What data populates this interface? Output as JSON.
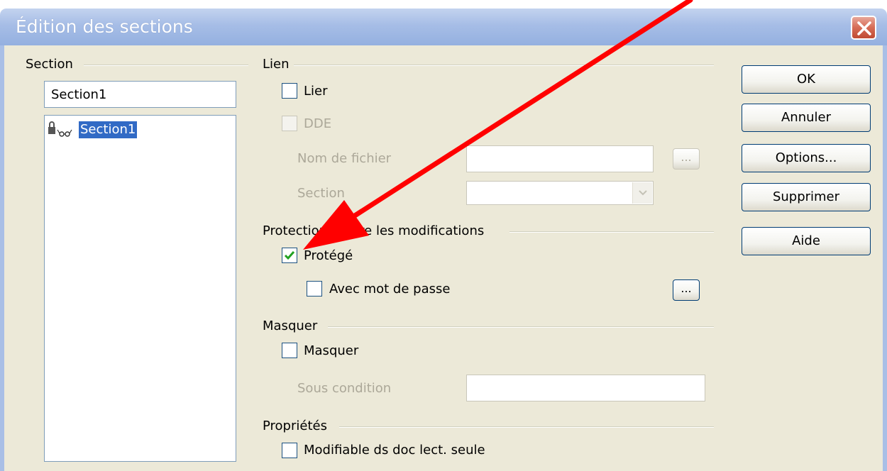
{
  "title": "Édition des sections",
  "section_group": {
    "label": "Section",
    "name_value": "Section1",
    "tree_item": "Section1"
  },
  "lien": {
    "label": "Lien",
    "lier": "Lier",
    "dde": "DDE",
    "nom_fichier": "Nom de fichier",
    "section": "Section",
    "browse": "..."
  },
  "protection": {
    "label": "Protection contre les modifications",
    "protege": "Protégé",
    "avec_mot_de_passe": "Avec mot de passe",
    "password_btn": "..."
  },
  "masquer": {
    "label": "Masquer",
    "masquer": "Masquer",
    "sous_condition": "Sous condition"
  },
  "proprietes": {
    "label": "Propriétés",
    "modifiable": "Modifiable ds doc lect. seule"
  },
  "buttons": {
    "ok": "OK",
    "annuler": "Annuler",
    "options": "Options...",
    "supprimer": "Supprimer",
    "aide": "Aide"
  },
  "colors": {
    "annotation_arrow": "#ff0000",
    "selection": "#316ac5",
    "checkmark": "#21a121"
  }
}
